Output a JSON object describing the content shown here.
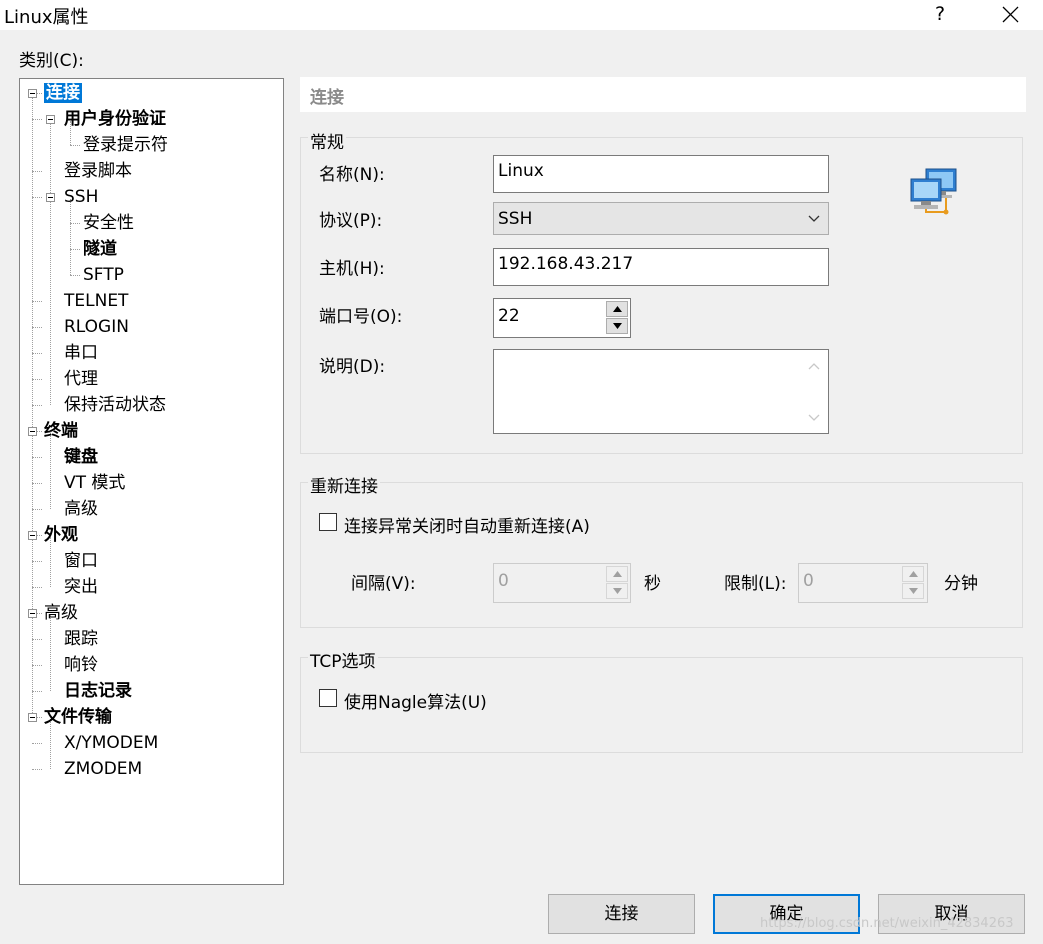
{
  "window": {
    "title": "Linux属性",
    "help": "?",
    "close_icon": "close-icon"
  },
  "category_label": "类别(C):",
  "tree": [
    {
      "label": "连接",
      "bold": true,
      "selected": true,
      "level": 0,
      "expander": true
    },
    {
      "label": "用户身份验证",
      "bold": true,
      "level": 1,
      "expander": true
    },
    {
      "label": "登录提示符",
      "level": 2
    },
    {
      "label": "登录脚本",
      "level": 1
    },
    {
      "label": "SSH",
      "level": 1,
      "expander": true
    },
    {
      "label": "安全性",
      "level": 2
    },
    {
      "label": "隧道",
      "bold": true,
      "level": 2
    },
    {
      "label": "SFTP",
      "level": 2
    },
    {
      "label": "TELNET",
      "level": 1
    },
    {
      "label": "RLOGIN",
      "level": 1
    },
    {
      "label": "串口",
      "level": 1
    },
    {
      "label": "代理",
      "level": 1
    },
    {
      "label": "保持活动状态",
      "level": 1
    },
    {
      "label": "终端",
      "bold": true,
      "level": 0,
      "expander": true
    },
    {
      "label": "键盘",
      "bold": true,
      "level": 1
    },
    {
      "label": "VT 模式",
      "level": 1
    },
    {
      "label": "高级",
      "level": 1
    },
    {
      "label": "外观",
      "bold": true,
      "level": 0,
      "expander": true
    },
    {
      "label": "窗口",
      "level": 1
    },
    {
      "label": "突出",
      "level": 1
    },
    {
      "label": "高级",
      "level": 0,
      "expander": true
    },
    {
      "label": "跟踪",
      "level": 1
    },
    {
      "label": "响铃",
      "level": 1
    },
    {
      "label": "日志记录",
      "bold": true,
      "level": 1
    },
    {
      "label": "文件传输",
      "bold": true,
      "level": 0,
      "expander": true
    },
    {
      "label": "X/YMODEM",
      "level": 1
    },
    {
      "label": "ZMODEM",
      "level": 1
    }
  ],
  "header": {
    "title": "连接"
  },
  "general": {
    "title": "常规",
    "name_label": "名称(N):",
    "name_value": "Linux",
    "protocol_label": "协议(P):",
    "protocol_value": "SSH",
    "host_label": "主机(H):",
    "host_value": "192.168.43.217",
    "port_label": "端口号(O):",
    "port_value": "22",
    "desc_label": "说明(D):",
    "desc_value": "",
    "icon": "network-computers-icon"
  },
  "reconnect": {
    "title": "重新连接",
    "auto_label": "连接异常关闭时自动重新连接(A)",
    "auto_checked": false,
    "interval_label": "间隔(V):",
    "interval_value": "0",
    "interval_unit": "秒",
    "limit_label": "限制(L):",
    "limit_value": "0",
    "limit_unit": "分钟"
  },
  "tcp": {
    "title": "TCP选项",
    "nagle_label": "使用Nagle算法(U)",
    "nagle_checked": false
  },
  "buttons": {
    "connect": "连接",
    "ok": "确定",
    "cancel": "取消"
  },
  "watermark": "https://blog.csdn.net/weixin_42834263"
}
